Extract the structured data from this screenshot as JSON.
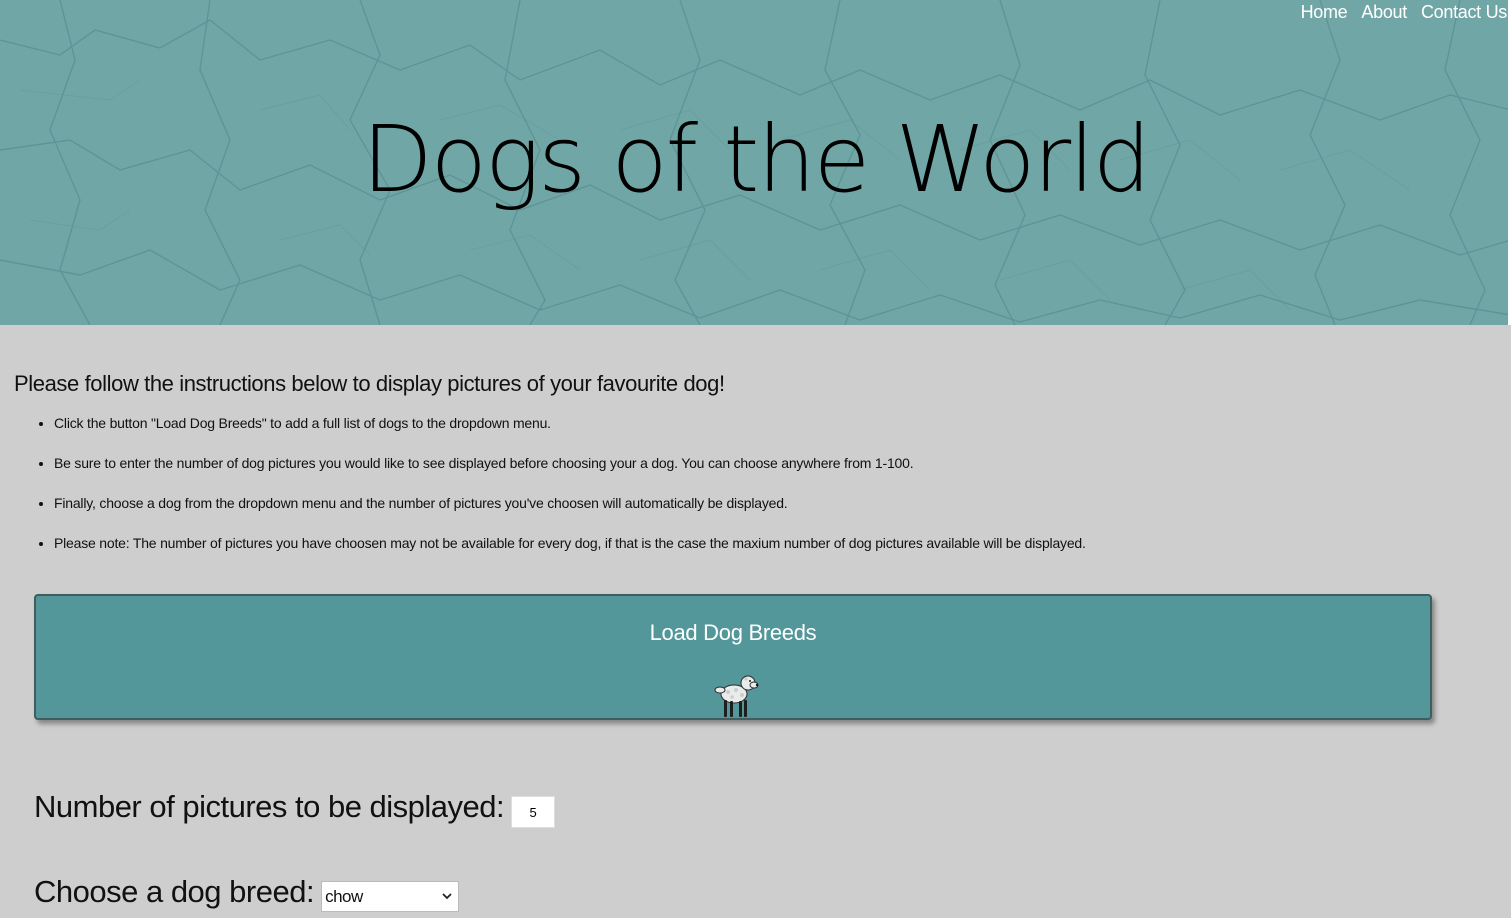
{
  "nav": {
    "items": [
      {
        "label": "Home"
      },
      {
        "label": "About"
      },
      {
        "label": "Contact Us"
      }
    ]
  },
  "hero": {
    "title": "Dogs of the World",
    "background_color": "#71a6a7"
  },
  "main": {
    "intro": "Please follow the instructions below to display pictures of your favourite dog!",
    "instructions": [
      "Click the button \"Load Dog Breeds\" to add a full list of dogs to the dropdown menu.",
      "Be sure to enter the number of dog pictures you would like to see displayed before choosing your a dog. You can choose anywhere from 1-100.",
      "Finally, choose a dog from the dropdown menu and the number of pictures you've choosen will automatically be displayed.",
      "Please note: The number of pictures you have choosen may not be available for every dog, if that is the case the maxium number of dog pictures available will be displayed."
    ],
    "load_button": {
      "label": "Load Dog Breeds",
      "icon": "dog-icon",
      "color": "#53979a"
    },
    "count_field": {
      "label": "Number of pictures to be displayed:",
      "value": "5"
    },
    "breed_field": {
      "label": "Choose a dog breed:",
      "selected": "chow"
    }
  }
}
